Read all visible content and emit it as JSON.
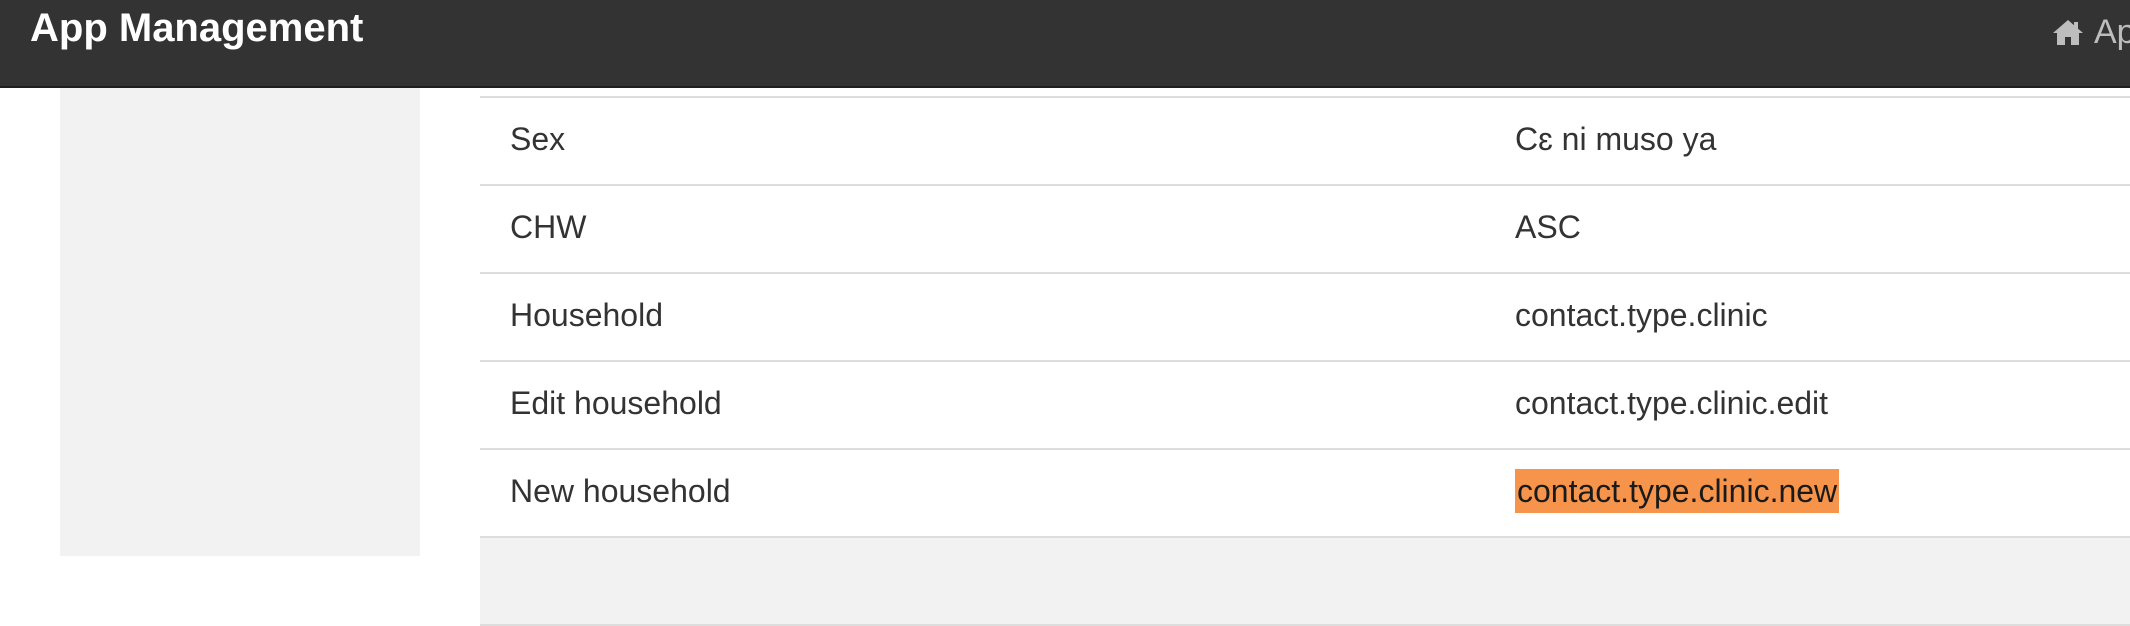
{
  "header": {
    "title": "App Management",
    "breadcrumb_text": "Ap",
    "breadcrumb_icon": "home-icon"
  },
  "table": {
    "rows": [
      {
        "key": "Sex",
        "value": "Cɛ ni muso ya",
        "highlighted": false
      },
      {
        "key": "CHW",
        "value": "ASC",
        "highlighted": false
      },
      {
        "key": "Household",
        "value": "contact.type.clinic",
        "highlighted": false
      },
      {
        "key": "Edit household",
        "value": "contact.type.clinic.edit",
        "highlighted": false
      },
      {
        "key": "New household",
        "value": "contact.type.clinic.new",
        "highlighted": true
      },
      {
        "key": "",
        "value": "",
        "highlighted": false
      }
    ]
  },
  "colors": {
    "header_bg": "#333333",
    "sidebar_bg": "#f2f2f2",
    "highlight": "#f5944a"
  }
}
